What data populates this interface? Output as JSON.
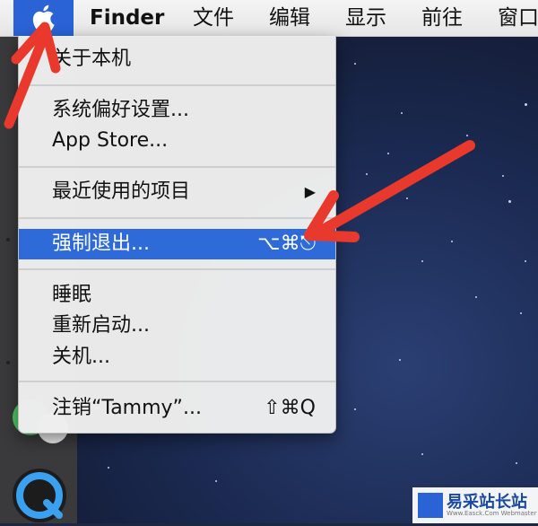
{
  "menubar": {
    "apple_icon": "apple-icon",
    "items": [
      {
        "label": "Finder",
        "bold": true
      },
      {
        "label": "文件"
      },
      {
        "label": "编辑"
      },
      {
        "label": "显示"
      },
      {
        "label": "前往"
      },
      {
        "label": "窗口"
      }
    ]
  },
  "apple_menu": {
    "items": [
      {
        "label": "关于本机"
      },
      {
        "label": "系统偏好设置..."
      },
      {
        "label": "App Store..."
      },
      {
        "label": "最近使用的项目",
        "submenu_icon": "triangle-right-icon",
        "submenu_glyph": "▶"
      },
      {
        "label": "强制退出...",
        "shortcut": "⌥⌘⎋",
        "selected": true
      },
      {
        "label": "睡眠"
      },
      {
        "label": "重新启动..."
      },
      {
        "label": "关机..."
      },
      {
        "label": "注销“Tammy”...",
        "shortcut": "⇧⌘Q"
      }
    ]
  },
  "annotations": {
    "arrow_color": "#e8392c"
  },
  "watermark": {
    "title": "易采站长站",
    "subtitle": "Www.Easck.Com Webmaster"
  },
  "colors": {
    "menu_selection": "#2f6bd8",
    "menubar_apple_highlight": "#2a63d6"
  }
}
